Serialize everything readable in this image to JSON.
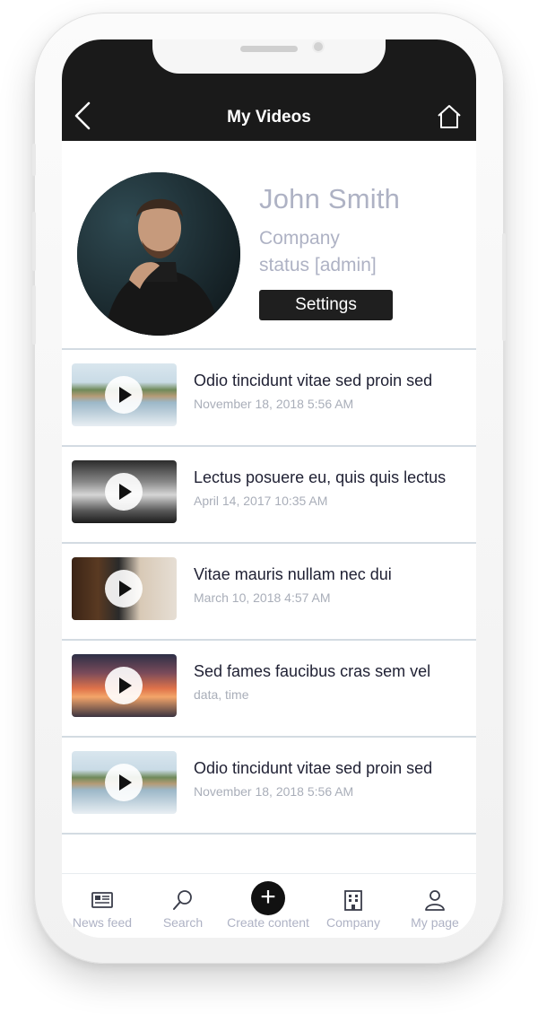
{
  "header": {
    "title": "My Videos"
  },
  "profile": {
    "name": "John Smith",
    "company": "Company",
    "status": "status [admin]",
    "settings_label": "Settings"
  },
  "videos": [
    {
      "title": "Odio tincidunt vitae sed proin sed",
      "date": "November 18, 2018 5:56 AM",
      "thumb": "beach"
    },
    {
      "title": "Lectus posuere eu, quis quis lectus",
      "date": "April 14, 2017 10:35 AM",
      "thumb": "market-bw"
    },
    {
      "title": "Vitae mauris nullam nec dui",
      "date": "March 10, 2018 4:57 AM",
      "thumb": "chalkboard-sign"
    },
    {
      "title": "Sed fames faucibus cras sem vel",
      "date": "data, time",
      "thumb": "sunset"
    },
    {
      "title": "Odio tincidunt vitae sed proin sed",
      "date": "November 18, 2018 5:56 AM",
      "thumb": "beach"
    }
  ],
  "nav": [
    {
      "label": "News feed",
      "icon": "newspaper-icon"
    },
    {
      "label": "Search",
      "icon": "search-icon"
    },
    {
      "label": "Create content",
      "icon": "plus-icon"
    },
    {
      "label": "Company",
      "icon": "building-icon"
    },
    {
      "label": "My page",
      "icon": "user-icon"
    }
  ],
  "colors": {
    "header_bg": "#1a1a1a",
    "muted_text": "#aeb2c4",
    "title_text": "#1f2033"
  }
}
